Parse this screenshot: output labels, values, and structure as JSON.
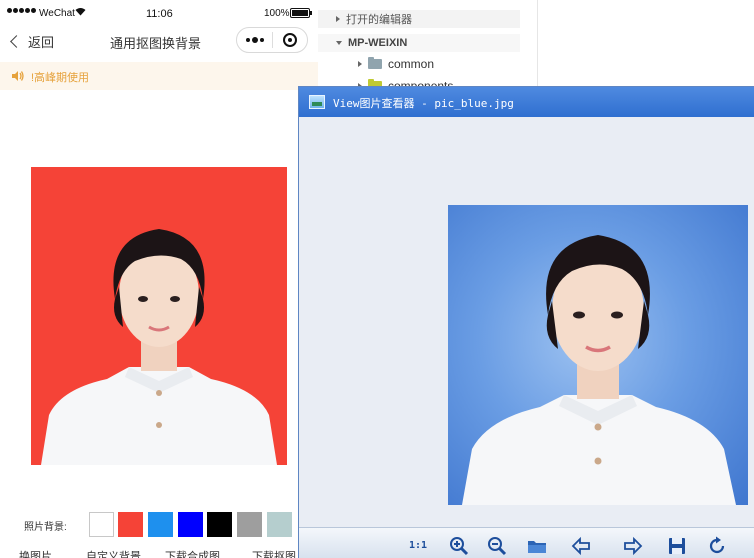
{
  "phone": {
    "status": {
      "carrier": "WeChat",
      "time": "11:06",
      "battery": "100%"
    },
    "nav": {
      "back_label": "返回",
      "title": "通用抠图换背景"
    },
    "notice": {
      "text": "!高峰期使用"
    },
    "background_label": "照片背景:",
    "swatches": [
      {
        "name": "white",
        "color": "#ffffff"
      },
      {
        "name": "red",
        "color": "#f54337"
      },
      {
        "name": "sky-blue",
        "color": "#1e90ee"
      },
      {
        "name": "blue",
        "color": "#0000ff"
      },
      {
        "name": "black",
        "color": "#000000"
      },
      {
        "name": "gray",
        "color": "#9e9e9e"
      },
      {
        "name": "light-cyan",
        "color": "#b5cece"
      }
    ],
    "actions": [
      "换图片",
      "自定义背景",
      "下载合成图",
      "下载抠图"
    ]
  },
  "explorer": {
    "open_editors": "打开的编辑器",
    "project": "MP-WEIXIN",
    "items": [
      {
        "label": "common",
        "folder_color": "#90a4ae"
      },
      {
        "label": "components",
        "folder_color": "#c0ca33"
      }
    ]
  },
  "viewer": {
    "title": "View图片查看器 - pic_blue.jpg",
    "toolbar": {
      "actual_size": "1:1",
      "icons": [
        "zoom-in-icon",
        "zoom-out-icon",
        "open-folder-icon",
        "previous-icon",
        "next-icon",
        "save-icon",
        "rotate-icon"
      ]
    }
  },
  "colors": {
    "accent_blue": "#2f6fd0",
    "notice_text": "#e6a23c",
    "red_bg": "#f54337"
  }
}
